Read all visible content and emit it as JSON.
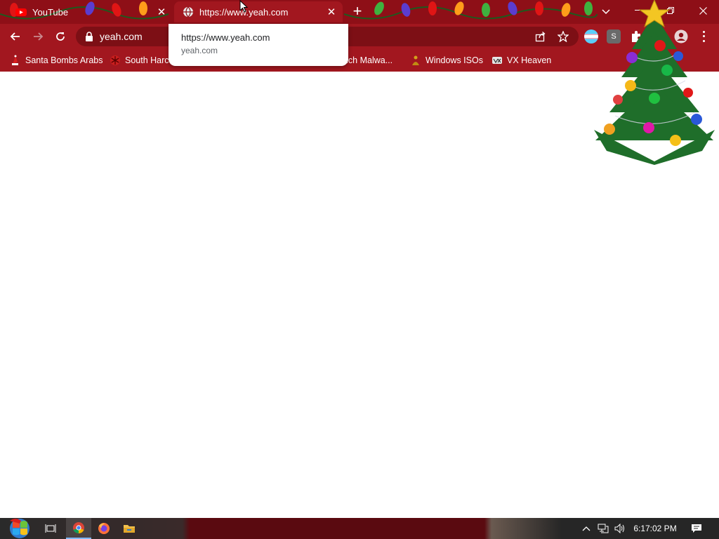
{
  "browser": {
    "tabs": [
      {
        "title": "YouTube",
        "favicon": "youtube-icon",
        "active": false
      },
      {
        "title": "https://www.yeah.com",
        "favicon": "globe-icon",
        "active": true
      }
    ],
    "address": "yeah.com",
    "tooltip": {
      "url": "https://www.yeah.com",
      "host": "yeah.com"
    },
    "extension_s_label": "S"
  },
  "bookmarks": [
    {
      "label": "Santa Bombs Arabs",
      "icon": "santa-icon"
    },
    {
      "label": "South Harc",
      "icon": "snowflake-icon"
    },
    {
      "label": "anch Malwa...",
      "icon": "folder-icon"
    },
    {
      "label": "Windows ISOs",
      "icon": "buddha-icon"
    },
    {
      "label": "VX Heaven",
      "icon": "vx-heaven-icon"
    }
  ],
  "taskbar": {
    "clock": "6:17:02 PM",
    "apps": [
      "task-view",
      "chrome",
      "firefox",
      "file-explorer"
    ]
  },
  "colors": {
    "tabstrip": "#8e0f17",
    "toolbar": "#a2171f",
    "omnibox": "#7d0f15"
  }
}
